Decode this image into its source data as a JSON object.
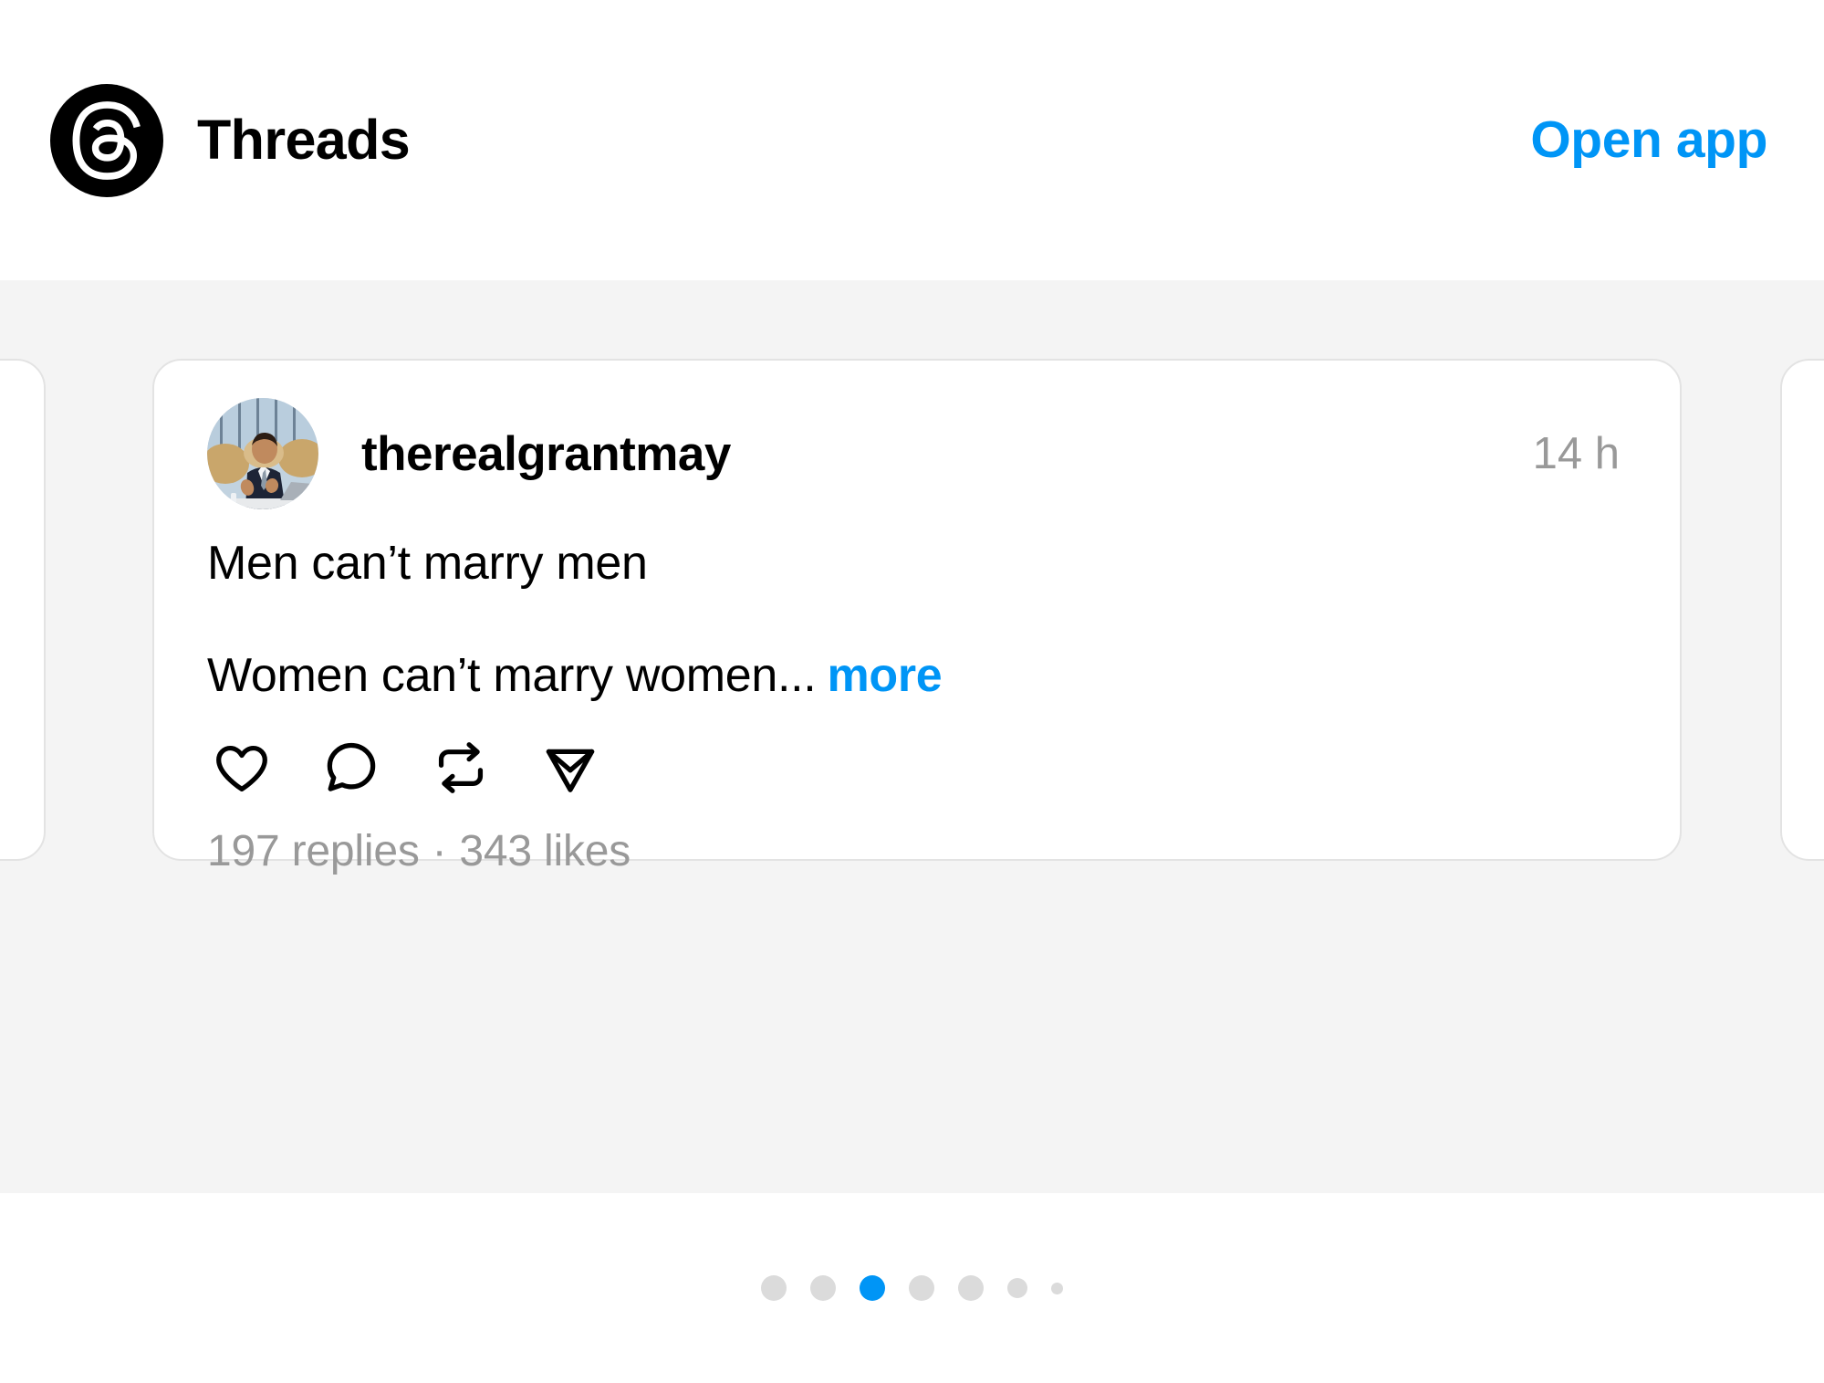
{
  "header": {
    "logo_icon": "threads-logo-icon",
    "brand_name": "Threads",
    "open_app_label": "Open app"
  },
  "colors": {
    "accent_blue": "#0095F6",
    "text_primary": "#000000",
    "text_secondary": "#999999",
    "strip_background": "#F4F4F4",
    "card_background": "#FFFFFF",
    "card_border": "#E3E3E3",
    "dot_inactive": "#DBDBDB"
  },
  "carousel": {
    "active_index": 2,
    "dots": [
      {
        "size": "lg",
        "active": false
      },
      {
        "size": "lg",
        "active": false
      },
      {
        "size": "lg",
        "active": true
      },
      {
        "size": "lg",
        "active": false
      },
      {
        "size": "lg",
        "active": false
      },
      {
        "size": "md",
        "active": false
      },
      {
        "size": "sm",
        "active": false
      }
    ]
  },
  "post": {
    "avatar_icon": "user-avatar",
    "username": "therealgrantmay",
    "timestamp": "14 h",
    "text_line_1": "Men can’t marry men",
    "text_line_2": "Women can’t marry women...",
    "more_label": "more",
    "actions": [
      {
        "name": "like-icon",
        "label": "Like"
      },
      {
        "name": "reply-icon",
        "label": "Reply"
      },
      {
        "name": "repost-icon",
        "label": "Repost"
      },
      {
        "name": "share-icon",
        "label": "Share"
      }
    ],
    "stats": {
      "replies": "197 replies",
      "separator": "·",
      "likes": "343 likes"
    }
  }
}
